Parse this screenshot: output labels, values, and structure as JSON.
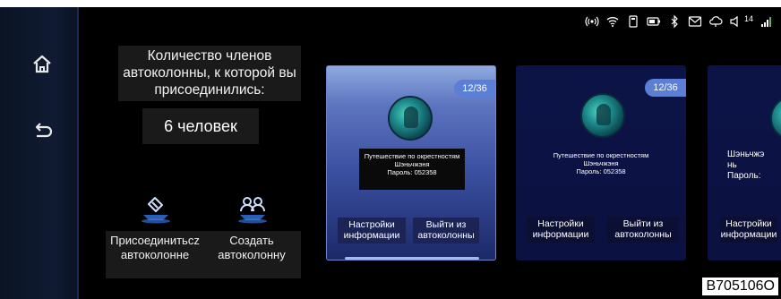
{
  "status": {
    "icons": [
      "hotspot-icon",
      "wifi-icon",
      "sim-icon",
      "battery-icon",
      "bluetooth-icon",
      "message-icon",
      "cloud-icon",
      "volume-icon",
      "signal-icon"
    ],
    "volume_value": "14"
  },
  "nav": {
    "items": [
      {
        "icon": "home-icon"
      },
      {
        "icon": "back-icon"
      }
    ]
  },
  "panel": {
    "info_text": "Количество членов автоколонны, к которой вы присоединились:",
    "count_text": "6 человек",
    "join_label": "Присоединитьсz автоколонне",
    "create_label": "Создать автоколонну"
  },
  "cards": [
    {
      "badge": "12/36",
      "desc_line1": "Путешествие по окрестностям",
      "desc_line2": "Шэньчжэня",
      "desc_line3": "Пароль: 052358",
      "btn_settings": "Настройки информации",
      "btn_exit": "Выйти из автоколонны"
    },
    {
      "badge": "12/36",
      "desc_line1": "Путешествие по окрестностям",
      "desc_line2": "Шэньчжэня",
      "desc_line3": "Пароль: 052358",
      "btn_settings": "Настройки информации",
      "btn_exit": "Выйти из автоколонны"
    },
    {
      "desc_line1": "Шэньчжэ",
      "desc_line2": "нь",
      "desc_line3": "Пароль:",
      "btn_settings": "Настройки информации"
    }
  ],
  "code_label": "B705106O",
  "colors": {
    "accent": "#5b7fd6",
    "card_active": "#5d74bf",
    "card_dark": "#0c1447",
    "rail": "#101b33"
  }
}
